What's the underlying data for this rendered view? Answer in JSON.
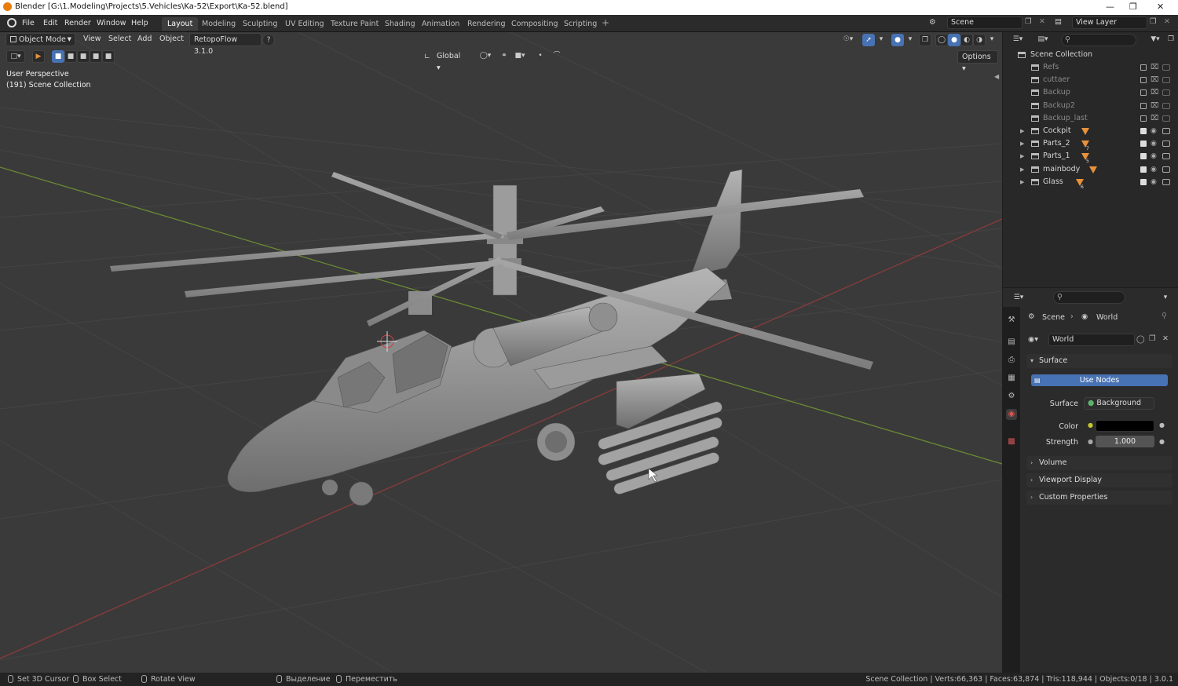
{
  "window": {
    "title": "Blender [G:\\1.Modeling\\Projects\\5.Vehicles\\Ka-52\\Export\\Ka-52.blend]"
  },
  "menu": [
    "File",
    "Edit",
    "Render",
    "Window",
    "Help"
  ],
  "workspaces": [
    "Layout",
    "Modeling",
    "Sculpting",
    "UV Editing",
    "Texture Paint",
    "Shading",
    "Animation",
    "Rendering",
    "Compositing",
    "Scripting"
  ],
  "active_workspace": "Layout",
  "scene": {
    "name": "Scene",
    "view_layer": "View Layer"
  },
  "viewport": {
    "mode": "Object Mode",
    "menus": [
      "View",
      "Select",
      "Add",
      "Object"
    ],
    "addon": "RetopoFlow 3.1.0",
    "orientation": "Global",
    "options_label": "Options",
    "perspective": "User Perspective",
    "collection_info": "(191) Scene Collection"
  },
  "outliner": {
    "root": "Scene Collection",
    "items": [
      {
        "name": "Refs",
        "enabled": false,
        "expandable": false
      },
      {
        "name": "cuttaer",
        "enabled": false,
        "expandable": false
      },
      {
        "name": "Backup",
        "enabled": false,
        "expandable": false
      },
      {
        "name": "Backup2",
        "enabled": false,
        "expandable": false
      },
      {
        "name": "Backup_last",
        "enabled": false,
        "expandable": false
      },
      {
        "name": "Cockpit",
        "enabled": true,
        "expandable": true,
        "badge": ""
      },
      {
        "name": "Parts_2",
        "enabled": true,
        "expandable": true,
        "badge": "7"
      },
      {
        "name": "Parts_1",
        "enabled": true,
        "expandable": true,
        "badge": "5"
      },
      {
        "name": "mainbody",
        "enabled": true,
        "expandable": true,
        "badge": ""
      },
      {
        "name": "Glass",
        "enabled": true,
        "expandable": true,
        "badge": "6"
      }
    ]
  },
  "properties": {
    "breadcrumb_scene": "Scene",
    "breadcrumb_world": "World",
    "world_name": "World",
    "surface_panel": "Surface",
    "use_nodes_label": "Use Nodes",
    "surface_label": "Surface",
    "surface_value": "Background",
    "color_label": "Color",
    "color_value": "#000000",
    "strength_label": "Strength",
    "strength_value": "1.000",
    "collapsed_panels": [
      "Volume",
      "Viewport Display",
      "Custom Properties"
    ]
  },
  "statusbar": {
    "hints": [
      "Set 3D Cursor",
      "Box Select",
      "Rotate View",
      "Выделение",
      "Переместить"
    ],
    "stats": "Scene Collection | Verts:66,363 | Faces:63,874 | Tris:118,944 | Objects:0/18 | 3.0.1"
  },
  "colors": {
    "accent": "#4772b3",
    "x_axis": "#8b3b3b",
    "y_axis": "#6b8a34",
    "collection_icon": "#e8913a"
  }
}
